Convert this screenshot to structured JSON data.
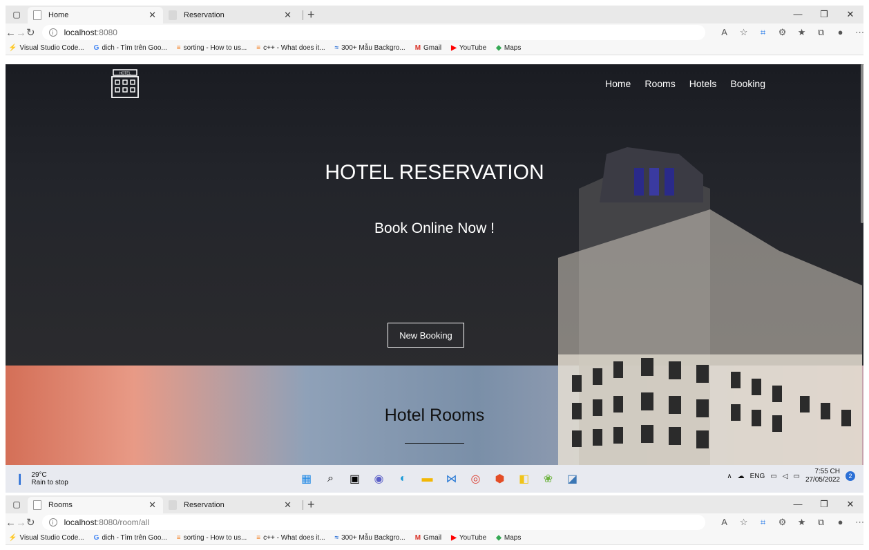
{
  "window1": {
    "tabs": [
      {
        "label": "Home",
        "active": true
      },
      {
        "label": "Reservation",
        "active": false
      }
    ],
    "url_host": "localhost",
    "url_path": ":8080"
  },
  "window2": {
    "tabs": [
      {
        "label": "Rooms",
        "active": true
      },
      {
        "label": "Reservation",
        "active": false
      }
    ],
    "url_host": "localhost",
    "url_path": ":8080/room/all"
  },
  "bookmarks": [
    {
      "label": "Visual Studio Code...",
      "icon": "bolt-icon"
    },
    {
      "label": "dich - Tìm trên Goo...",
      "icon": "google-icon"
    },
    {
      "label": "sorting - How to us...",
      "icon": "stackoverflow-icon"
    },
    {
      "label": "c++ - What does it...",
      "icon": "stackoverflow-icon"
    },
    {
      "label": "300+ Mẫu Backgro...",
      "icon": "wave-icon"
    },
    {
      "label": "Gmail",
      "icon": "gmail-icon"
    },
    {
      "label": "YouTube",
      "icon": "youtube-icon"
    },
    {
      "label": "Maps",
      "icon": "maps-icon"
    }
  ],
  "page": {
    "logo_text": "HOTEL",
    "nav": [
      "Home",
      "Rooms",
      "Hotels",
      "Booking"
    ],
    "title": "HOTEL RESERVATION",
    "subtitle": "Book Online Now !",
    "button": "New Booking",
    "rooms_heading": "Hotel Rooms"
  },
  "taskbar": {
    "temp": "29°C",
    "weather": "Rain to stop",
    "lang": "ENG",
    "time": "7:55 CH",
    "date": "27/05/2022",
    "notifications": "2"
  },
  "colors": {
    "hero_dark": "#1f2127",
    "accent_blue": "#1a73e8"
  }
}
